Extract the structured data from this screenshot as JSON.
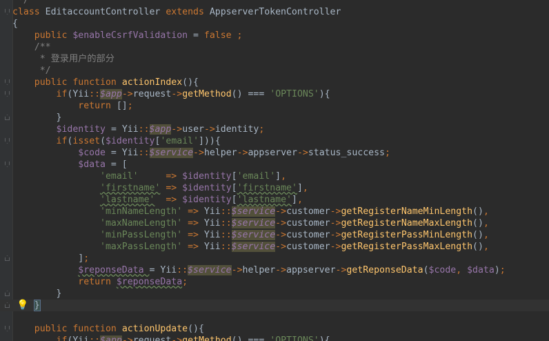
{
  "editor": {
    "colors": {
      "background": "#2b2b2b",
      "keyword": "#cc7832",
      "variable": "#9876aa",
      "function": "#ffc66d",
      "string": "#6a8759",
      "comment": "#808080",
      "text": "#a9b7c6"
    },
    "lines": [
      {
        "tokens": [
          {
            "c": "c",
            "t": " */"
          }
        ]
      },
      {
        "tokens": [
          {
            "c": "k",
            "t": "class "
          },
          {
            "c": "t",
            "t": "EditaccountController "
          },
          {
            "c": "k",
            "t": "extends "
          },
          {
            "c": "t",
            "t": "AppserverTokenController"
          }
        ]
      },
      {
        "tokens": [
          {
            "c": "t",
            "t": "{"
          }
        ]
      },
      {
        "tokens": [
          {
            "c": "t",
            "t": "    "
          },
          {
            "c": "k",
            "t": "public "
          },
          {
            "c": "v",
            "t": "$enableCsrfValidation "
          },
          {
            "c": "t",
            "t": "= "
          },
          {
            "c": "k",
            "t": "false ;"
          }
        ]
      },
      {
        "tokens": [
          {
            "c": "c",
            "t": "    /**"
          }
        ]
      },
      {
        "tokens": [
          {
            "c": "c",
            "t": "     * 登录用户的部分"
          }
        ]
      },
      {
        "tokens": [
          {
            "c": "c",
            "t": "     */"
          }
        ]
      },
      {
        "tokens": [
          {
            "c": "t",
            "t": "    "
          },
          {
            "c": "k",
            "t": "public function "
          },
          {
            "c": "f",
            "t": "actionIndex"
          },
          {
            "c": "t",
            "t": "(){"
          }
        ]
      },
      {
        "tokens": [
          {
            "c": "t",
            "t": "        "
          },
          {
            "c": "k",
            "t": "if"
          },
          {
            "c": "t",
            "t": "(Yii"
          },
          {
            "c": "k",
            "t": "::"
          },
          {
            "c": "vi",
            "t": "$app"
          },
          {
            "c": "k",
            "t": "->"
          },
          {
            "c": "t",
            "t": "request"
          },
          {
            "c": "k",
            "t": "->"
          },
          {
            "c": "f",
            "t": "getMethod"
          },
          {
            "c": "t",
            "t": "() === "
          },
          {
            "c": "s",
            "t": "'OPTIONS'"
          },
          {
            "c": "t",
            "t": "){"
          }
        ]
      },
      {
        "tokens": [
          {
            "c": "t",
            "t": "            "
          },
          {
            "c": "k",
            "t": "return "
          },
          {
            "c": "t",
            "t": "[]"
          },
          {
            "c": "k",
            "t": ";"
          }
        ]
      },
      {
        "tokens": [
          {
            "c": "t",
            "t": "        }"
          }
        ]
      },
      {
        "tokens": [
          {
            "c": "t",
            "t": "        "
          },
          {
            "c": "v",
            "t": "$identity "
          },
          {
            "c": "t",
            "t": "= Yii"
          },
          {
            "c": "k",
            "t": "::"
          },
          {
            "c": "vi",
            "t": "$app"
          },
          {
            "c": "k",
            "t": "->"
          },
          {
            "c": "t",
            "t": "user"
          },
          {
            "c": "k",
            "t": "->"
          },
          {
            "c": "t",
            "t": "identity"
          },
          {
            "c": "k",
            "t": ";"
          }
        ]
      },
      {
        "tokens": [
          {
            "c": "t",
            "t": "        "
          },
          {
            "c": "k",
            "t": "if"
          },
          {
            "c": "t",
            "t": "("
          },
          {
            "c": "k",
            "t": "isset"
          },
          {
            "c": "t",
            "t": "("
          },
          {
            "c": "v",
            "t": "$identity"
          },
          {
            "c": "t",
            "t": "["
          },
          {
            "c": "s",
            "t": "'email'"
          },
          {
            "c": "t",
            "t": "])){"
          }
        ]
      },
      {
        "tokens": [
          {
            "c": "t",
            "t": "            "
          },
          {
            "c": "v",
            "t": "$code "
          },
          {
            "c": "t",
            "t": "= Yii"
          },
          {
            "c": "k",
            "t": "::"
          },
          {
            "c": "vi",
            "t": "$service"
          },
          {
            "c": "k",
            "t": "->"
          },
          {
            "c": "t",
            "t": "helper"
          },
          {
            "c": "k",
            "t": "->"
          },
          {
            "c": "t",
            "t": "appserver"
          },
          {
            "c": "k",
            "t": "->"
          },
          {
            "c": "t",
            "t": "status_success"
          },
          {
            "c": "k",
            "t": ";"
          }
        ]
      },
      {
        "tokens": [
          {
            "c": "t",
            "t": "            "
          },
          {
            "c": "v",
            "t": "$data "
          },
          {
            "c": "t",
            "t": "= ["
          }
        ]
      },
      {
        "tokens": [
          {
            "c": "t",
            "t": "                "
          },
          {
            "c": "s",
            "t": "'email'"
          },
          {
            "c": "t",
            "t": "     "
          },
          {
            "c": "k",
            "t": "=> "
          },
          {
            "c": "v",
            "t": "$identity"
          },
          {
            "c": "t",
            "t": "["
          },
          {
            "c": "s",
            "t": "'email'"
          },
          {
            "c": "t",
            "t": "]"
          },
          {
            "c": "k",
            "t": ","
          }
        ]
      },
      {
        "tokens": [
          {
            "c": "t",
            "t": "                "
          },
          {
            "c": "s",
            "t": "'firstname'"
          },
          {
            "c": "t",
            "t": " "
          },
          {
            "c": "k",
            "t": "=> "
          },
          {
            "c": "v",
            "t": "$identity"
          },
          {
            "c": "t",
            "t": "["
          },
          {
            "c": "s",
            "t": "'firstname'"
          },
          {
            "c": "t",
            "t": "]"
          },
          {
            "c": "k",
            "t": ","
          }
        ]
      },
      {
        "tokens": [
          {
            "c": "t",
            "t": "                "
          },
          {
            "c": "s",
            "t": "'lastname'"
          },
          {
            "c": "t",
            "t": "  "
          },
          {
            "c": "k",
            "t": "=> "
          },
          {
            "c": "v",
            "t": "$identity"
          },
          {
            "c": "t",
            "t": "["
          },
          {
            "c": "s",
            "t": "'lastname'"
          },
          {
            "c": "t",
            "t": "]"
          },
          {
            "c": "k",
            "t": ","
          }
        ]
      },
      {
        "tokens": [
          {
            "c": "t",
            "t": "                "
          },
          {
            "c": "s",
            "t": "'minNameLength'"
          },
          {
            "c": "t",
            "t": " "
          },
          {
            "c": "k",
            "t": "=> "
          },
          {
            "c": "t",
            "t": "Yii"
          },
          {
            "c": "k",
            "t": "::"
          },
          {
            "c": "vi",
            "t": "$service"
          },
          {
            "c": "k",
            "t": "->"
          },
          {
            "c": "t",
            "t": "customer"
          },
          {
            "c": "k",
            "t": "->"
          },
          {
            "c": "f",
            "t": "getRegisterNameMinLength"
          },
          {
            "c": "t",
            "t": "()"
          },
          {
            "c": "k",
            "t": ","
          }
        ]
      },
      {
        "tokens": [
          {
            "c": "t",
            "t": "                "
          },
          {
            "c": "s",
            "t": "'maxNameLength'"
          },
          {
            "c": "t",
            "t": " "
          },
          {
            "c": "k",
            "t": "=> "
          },
          {
            "c": "t",
            "t": "Yii"
          },
          {
            "c": "k",
            "t": "::"
          },
          {
            "c": "vi",
            "t": "$service"
          },
          {
            "c": "k",
            "t": "->"
          },
          {
            "c": "t",
            "t": "customer"
          },
          {
            "c": "k",
            "t": "->"
          },
          {
            "c": "f",
            "t": "getRegisterNameMaxLength"
          },
          {
            "c": "t",
            "t": "()"
          },
          {
            "c": "k",
            "t": ","
          }
        ]
      },
      {
        "tokens": [
          {
            "c": "t",
            "t": "                "
          },
          {
            "c": "s",
            "t": "'minPassLength'"
          },
          {
            "c": "t",
            "t": " "
          },
          {
            "c": "k",
            "t": "=> "
          },
          {
            "c": "t",
            "t": "Yii"
          },
          {
            "c": "k",
            "t": "::"
          },
          {
            "c": "vi",
            "t": "$service"
          },
          {
            "c": "k",
            "t": "->"
          },
          {
            "c": "t",
            "t": "customer"
          },
          {
            "c": "k",
            "t": "->"
          },
          {
            "c": "f",
            "t": "getRegisterPassMinLength"
          },
          {
            "c": "t",
            "t": "()"
          },
          {
            "c": "k",
            "t": ","
          }
        ]
      },
      {
        "tokens": [
          {
            "c": "t",
            "t": "                "
          },
          {
            "c": "s",
            "t": "'maxPassLength'"
          },
          {
            "c": "t",
            "t": " "
          },
          {
            "c": "k",
            "t": "=> "
          },
          {
            "c": "t",
            "t": "Yii"
          },
          {
            "c": "k",
            "t": "::"
          },
          {
            "c": "vi",
            "t": "$service"
          },
          {
            "c": "k",
            "t": "->"
          },
          {
            "c": "t",
            "t": "customer"
          },
          {
            "c": "k",
            "t": "->"
          },
          {
            "c": "f",
            "t": "getRegisterPassMaxLength"
          },
          {
            "c": "t",
            "t": "()"
          },
          {
            "c": "k",
            "t": ","
          }
        ]
      },
      {
        "tokens": [
          {
            "c": "t",
            "t": "            ]"
          },
          {
            "c": "k",
            "t": ";"
          }
        ]
      },
      {
        "tokens": [
          {
            "c": "t",
            "t": "            "
          },
          {
            "c": "v",
            "t": "$reponseData "
          },
          {
            "c": "t",
            "t": "= Yii"
          },
          {
            "c": "k",
            "t": "::"
          },
          {
            "c": "vi",
            "t": "$service"
          },
          {
            "c": "k",
            "t": "->"
          },
          {
            "c": "t",
            "t": "helper"
          },
          {
            "c": "k",
            "t": "->"
          },
          {
            "c": "t",
            "t": "appserver"
          },
          {
            "c": "k",
            "t": "->"
          },
          {
            "c": "f",
            "t": "getReponseData"
          },
          {
            "c": "t",
            "t": "("
          },
          {
            "c": "v",
            "t": "$code"
          },
          {
            "c": "k",
            "t": ", "
          },
          {
            "c": "v",
            "t": "$data"
          },
          {
            "c": "t",
            "t": ")"
          },
          {
            "c": "k",
            "t": ";"
          }
        ]
      },
      {
        "tokens": [
          {
            "c": "t",
            "t": "            "
          },
          {
            "c": "k",
            "t": "return "
          },
          {
            "c": "v",
            "t": "$reponseData"
          },
          {
            "c": "k",
            "t": ";"
          }
        ]
      },
      {
        "tokens": [
          {
            "c": "t",
            "t": "        }"
          }
        ]
      },
      {
        "tokens": [
          {
            "c": "t",
            "t": "    "
          },
          {
            "c": "hl",
            "t": "}"
          }
        ]
      },
      {
        "tokens": [
          {
            "c": "t",
            "t": ""
          }
        ]
      },
      {
        "tokens": [
          {
            "c": "t",
            "t": "    "
          },
          {
            "c": "k",
            "t": "public function "
          },
          {
            "c": "f",
            "t": "actionUpdate"
          },
          {
            "c": "t",
            "t": "(){"
          }
        ]
      },
      {
        "tokens": [
          {
            "c": "t",
            "t": "        "
          },
          {
            "c": "k",
            "t": "if"
          },
          {
            "c": "t",
            "t": "(Yii"
          },
          {
            "c": "k",
            "t": "::"
          },
          {
            "c": "vi",
            "t": "$app"
          },
          {
            "c": "k",
            "t": "->"
          },
          {
            "c": "t",
            "t": "request"
          },
          {
            "c": "k",
            "t": "->"
          },
          {
            "c": "f",
            "t": "getMethod"
          },
          {
            "c": "t",
            "t": "() === "
          },
          {
            "c": "s",
            "t": "'OPTIONS'"
          },
          {
            "c": "t",
            "t": "){"
          }
        ]
      }
    ]
  }
}
